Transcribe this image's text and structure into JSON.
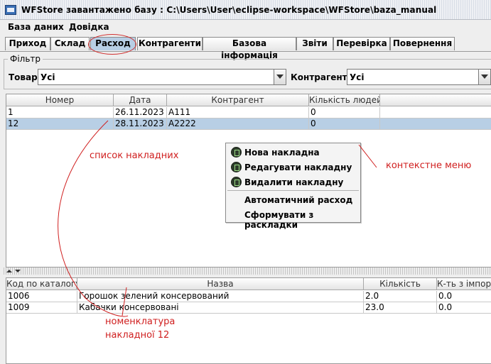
{
  "window": {
    "title": "WFStore завантажено базу : C:\\Users\\User\\eclipse-workspace\\WFStore\\baza_manual",
    "app_icon": "app-window-icon"
  },
  "menubar": {
    "items": [
      "База даних",
      "Довідка"
    ]
  },
  "tabs": {
    "items": [
      "Приход",
      "Склад",
      "Расход",
      "Контрагенти",
      "Базова інформація",
      "Звіти",
      "Перевірка",
      "Повернення"
    ],
    "active": "Расход"
  },
  "filter": {
    "legend": "Фільтр",
    "goods_label": "Товар :",
    "goods_value": "Усі",
    "counterparty_label": "Контрагенти :",
    "counterparty_value": "Усі"
  },
  "invoices_table": {
    "headers": [
      "Номер",
      "Дата",
      "Контрагент",
      "Кількість людей"
    ],
    "rows": [
      [
        "1",
        "26.11.2023",
        "A111",
        "0"
      ],
      [
        "12",
        "28.11.2023",
        "A2222",
        "0"
      ]
    ],
    "selected_row": 1
  },
  "context_menu": {
    "items": [
      {
        "label": "Нова накладна",
        "icon": "new-document-icon"
      },
      {
        "label": "Редагувати накладну",
        "icon": "edit-document-icon"
      },
      {
        "label": "Видалити накладну",
        "icon": "delete-document-icon"
      },
      {
        "label": "Автоматичний расход",
        "icon": ""
      },
      {
        "label": "Сформувати з раскладки",
        "icon": ""
      }
    ]
  },
  "items_table": {
    "headers": [
      "Код по каталогу",
      "Назва",
      "Кількість",
      "К-ть з імпорту"
    ],
    "rows": [
      [
        "1006",
        "Горошок зелений консервований",
        "2.0",
        "0.0"
      ],
      [
        "1009",
        "Кабачки консервовані",
        "23.0",
        "0.0"
      ]
    ]
  },
  "annotations": {
    "invoice_list": "список накладних",
    "context_menu": "контекстне меню",
    "nomenclature_line1": "номенклатура",
    "nomenclature_line2": "накладної 12"
  },
  "colors": {
    "selection": "#b8cfe5",
    "annotation": "#d02020",
    "active_tab": "#b8cfe5"
  }
}
